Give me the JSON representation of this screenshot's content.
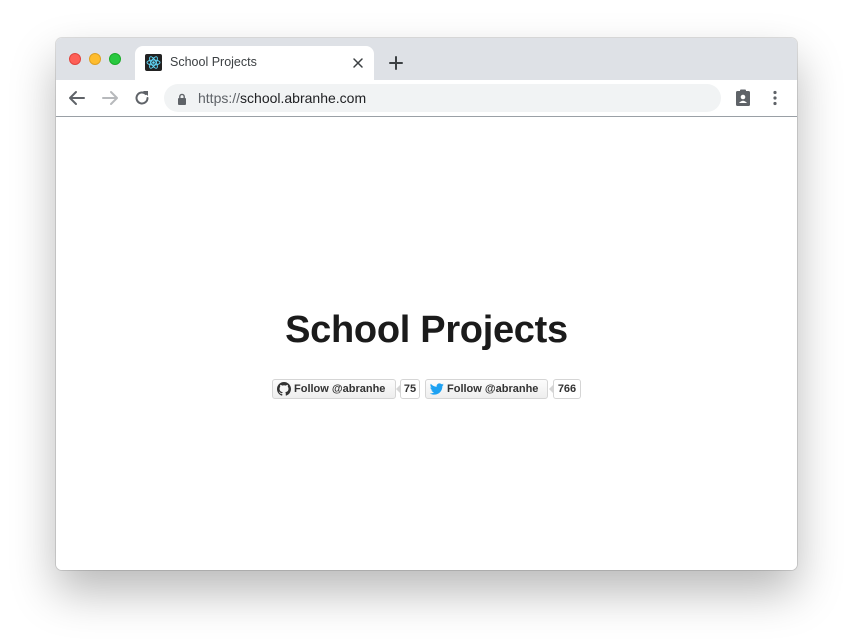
{
  "browser": {
    "tab": {
      "title": "School Projects",
      "favicon": "react-atom-icon"
    },
    "new_tab_icon": "plus-icon",
    "address": {
      "scheme": "https://",
      "host": "school.abranhe.com"
    },
    "toolbar_icons": [
      "back-arrow-icon",
      "forward-arrow-icon",
      "reload-icon",
      "lock-icon",
      "clipboard-profile-icon",
      "more-vertical-icon"
    ]
  },
  "page": {
    "title": "School Projects",
    "github": {
      "label": "Follow @abranhe",
      "count": "75",
      "icon": "github-icon"
    },
    "twitter": {
      "label": "Follow @abranhe",
      "count": "766",
      "icon": "twitter-bird-icon",
      "color": "#1da1f2"
    }
  },
  "colors": {
    "tabstrip": "#dee1e6",
    "omnibox": "#f1f3f4",
    "title_text": "#1b1b1b"
  }
}
